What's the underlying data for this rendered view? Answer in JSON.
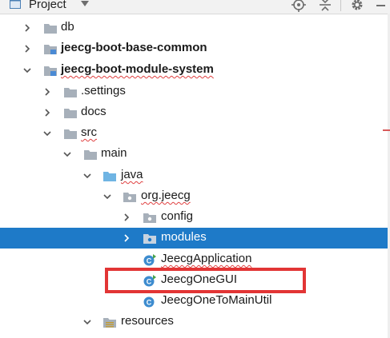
{
  "toolbar": {
    "title": "Project",
    "icons": [
      "project-view-icon",
      "dropdown-arrow-icon",
      "locate-target-icon",
      "collapse-all-icon",
      "gear-icon",
      "minimize-icon"
    ]
  },
  "tree": {
    "items": [
      {
        "label": "db",
        "type": "folder",
        "expanded": false
      },
      {
        "label": "jeecg-boot-base-common",
        "type": "module",
        "expanded": false
      },
      {
        "label": "jeecg-boot-module-system",
        "type": "module",
        "expanded": true
      },
      {
        "label": ".settings",
        "type": "folder",
        "expanded": false
      },
      {
        "label": "docs",
        "type": "folder",
        "expanded": false
      },
      {
        "label": "src",
        "type": "folder",
        "expanded": true
      },
      {
        "label": "main",
        "type": "folder",
        "expanded": true
      },
      {
        "label": "java",
        "type": "source-folder",
        "expanded": true
      },
      {
        "label": "org.jeecg",
        "type": "package",
        "expanded": true
      },
      {
        "label": "config",
        "type": "package",
        "expanded": false
      },
      {
        "label": "modules",
        "type": "package",
        "expanded": false,
        "selected": true
      },
      {
        "label": "JeecgApplication",
        "type": "class"
      },
      {
        "label": "JeecgOneGUI",
        "type": "class"
      },
      {
        "label": "JeecgOneToMainUtil",
        "type": "class"
      },
      {
        "label": "resources",
        "type": "resources-folder",
        "expanded": true
      }
    ]
  },
  "colors": {
    "selection": "#1e7ac8",
    "highlight_box": "#e23535",
    "folder": "#a7b0ba",
    "source_folder": "#6fb4e3",
    "class_icon": "#3d8ccf"
  }
}
